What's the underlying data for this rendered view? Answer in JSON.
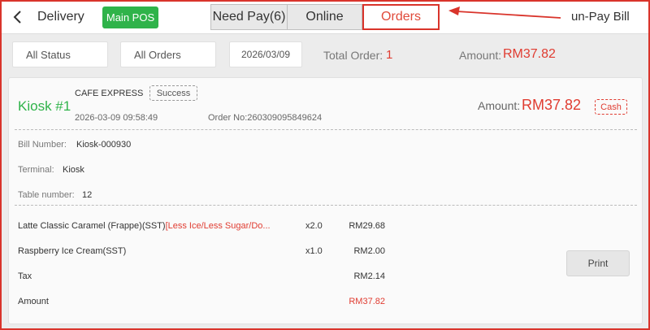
{
  "header": {
    "title": "Delivery",
    "main_pos": "Main POS",
    "tabs": [
      {
        "label": "Need Pay(6)",
        "active": false
      },
      {
        "label": "Online",
        "active": false
      },
      {
        "label": "Orders",
        "active": true
      }
    ],
    "unpay_bill": "un-Pay Bill"
  },
  "filters": {
    "status": "All Status",
    "orders": "All Orders",
    "date": "2026/03/09",
    "total_order_label": "Total Order:",
    "total_order_value": "1",
    "amount_label": "Amount:",
    "amount_value": "RM37.82"
  },
  "order": {
    "kiosk": "Kiosk #1",
    "store": "CAFE EXPRESS",
    "status": "Success",
    "datetime": "2026-03-09 09:58:49",
    "order_no": "Order No:260309095849624",
    "amount_label": "Amount:",
    "amount_value": "RM37.82",
    "payment": "Cash",
    "bill_number_label": "Bill Number:",
    "bill_number": "Kiosk-000930",
    "terminal_label": "Terminal:",
    "terminal": "Kiosk",
    "table_label": "Table number:",
    "table": "12",
    "items": [
      {
        "name": "Latte Classic Caramel (Frappe)(SST)",
        "modifiers": "[Less Ice/Less Sugar/Do...",
        "qty": "x2.0",
        "price": "RM29.68"
      },
      {
        "name": "Raspberry Ice Cream(SST)",
        "modifiers": "",
        "qty": "x1.0",
        "price": "RM2.00"
      }
    ],
    "tax_label": "Tax",
    "tax_value": "RM2.14",
    "total_label": "Amount",
    "total_value": "RM37.82",
    "print_label": "Print"
  },
  "colors": {
    "accent_green": "#2fb34a",
    "accent_red": "#e03c31",
    "annotation_red": "#d9342b"
  }
}
